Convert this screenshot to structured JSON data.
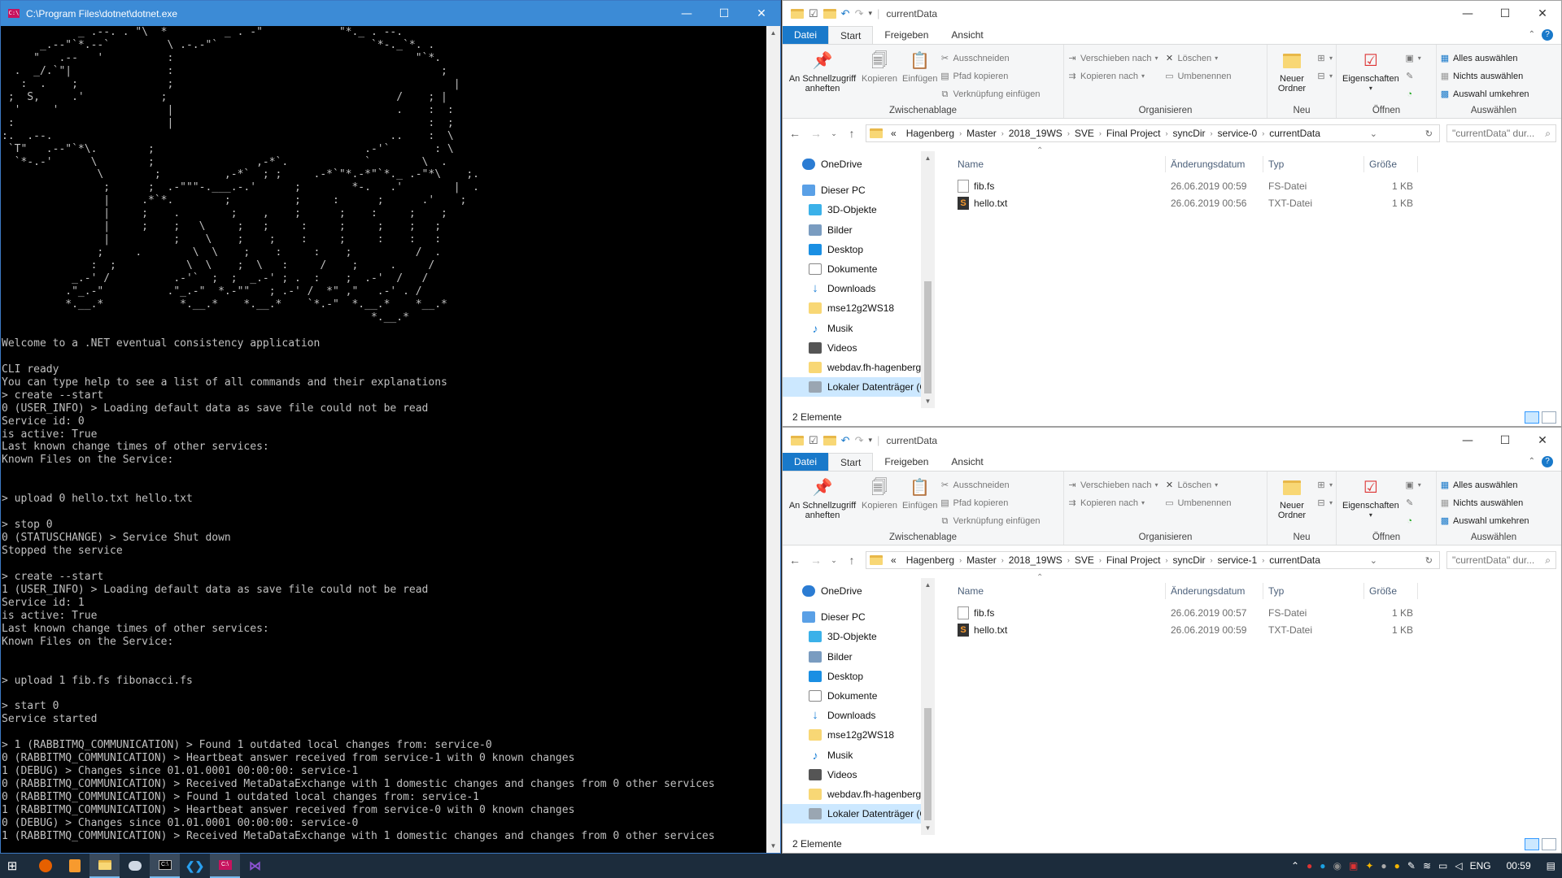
{
  "console": {
    "title": "C:\\Program Files\\dotnet\\dotnet.exe",
    "icon_label": "C:\\",
    "controls": {
      "minimize": "—",
      "maximize": "☐",
      "close": "✕"
    },
    "ascii_art": "            _ .--. . \"\\  *         _ . -\"            \"*._ . --.\n      _.--\"`*.--`         \\ .-.-\"`                        `*-._`*. .\n     \"   .--   '          :                                      \"`*.\n  .  _/.`\"|               :                                          ;\n   :  .    ;              ;                                            |\n ;  S,     .'            ;                                    /    ; |\n  '     '                 |                                   .    :  :\n :                        |                                        :  ;\n:.  .--.                                                     ..    :  \\\n `T\"   .--\"`*\\.        ;                                 .-'`       : \\\n  `*-.-'      \\        ;                ,-*`.            `        \\  .\n               \\        ;          ,-*`  ; ;     .-*`\"*.-*\"`*._ .-\"*\\    ;.\n                ;      ;  .-\"\"\"-.___.-.'      ;        *-.   .'        |  .\n                |     .*`*.        ;          ;     :      ;      .'    ;\n                |     ;    .        ;    ,    ;      ;    :     ;    ;\n                |     ;    ;   \\     ;   ;     :     ;     ;    ;   ;\n                |          ;    \\    ;    ;    :     ;     :    :   :\n               ;     .        \\  \\    ;    :     :    ;          /  .\n              :  ;           \\  \\    ;  \\   :     /    ;     .     /\n           _.-' /          .-'`  ;  ;  _.-' ; .  :    ;  .-'  /   /\n          .\"_.-\"          .\"_.-\"  *.-\"\"   ; .-' /  *\" ,\"   .-' . /\n          *.__.*            *.__.*    *.__.*    `*.-\"  *.__.*    *__.*\n                                                          *.__.*",
    "log_lines": [
      "",
      "Welcome to a .NET eventual consistency application",
      "",
      "CLI ready",
      "You can type help to see a list of all commands and their explanations",
      "> create --start",
      "0 (USER_INFO) > Loading default data as save file could not be read",
      "Service id: 0",
      "is active: True",
      "Last known change times of other services:",
      "Known Files on the Service:",
      "",
      "",
      "> upload 0 hello.txt hello.txt",
      "",
      "> stop 0",
      "0 (STATUSCHANGE) > Service Shut down",
      "Stopped the service",
      "",
      "> create --start",
      "1 (USER_INFO) > Loading default data as save file could not be read",
      "Service id: 1",
      "is active: True",
      "Last known change times of other services:",
      "Known Files on the Service:",
      "",
      "",
      "> upload 1 fib.fs fibonacci.fs",
      "",
      "> start 0",
      "Service started",
      "",
      "> 1 (RABBITMQ_COMMUNICATION) > Found 1 outdated local changes from: service-0",
      "0 (RABBITMQ_COMMUNICATION) > Heartbeat answer received from service-1 with 0 known changes",
      "1 (DEBUG) > Changes since 01.01.0001 00:00:00: service-1",
      "0 (RABBITMQ_COMMUNICATION) > Received MetaDataExchange with 1 domestic changes and changes from 0 other services",
      "0 (RABBITMQ_COMMUNICATION) > Found 1 outdated local changes from: service-1",
      "1 (RABBITMQ_COMMUNICATION) > Heartbeat answer received from service-0 with 0 known changes",
      "0 (DEBUG) > Changes since 01.01.0001 00:00:00: service-0",
      "1 (RABBITMQ_COMMUNICATION) > Received MetaDataExchange with 1 domestic changes and changes from 0 other services"
    ]
  },
  "explorer_common": {
    "window_title": "currentData",
    "tabs": {
      "file": "Datei",
      "start": "Start",
      "share": "Freigeben",
      "view": "Ansicht"
    },
    "help": "?",
    "ribbon": {
      "pin_quick": "An Schnellzugriff anheften",
      "copy": "Kopieren",
      "paste": "Einfügen",
      "cut": "Ausschneiden",
      "copy_path": "Pfad kopieren",
      "paste_shortcut": "Verknüpfung einfügen",
      "group_clipboard": "Zwischenablage",
      "move_to": "Verschieben nach",
      "copy_to": "Kopieren nach",
      "delete": "Löschen",
      "rename": "Umbenennen",
      "group_organize": "Organisieren",
      "new_folder": "Neuer Ordner",
      "group_new": "Neu",
      "properties": "Eigenschaften",
      "group_open": "Öffnen",
      "select_all": "Alles auswählen",
      "select_none": "Nichts auswählen",
      "invert_selection": "Auswahl umkehren",
      "group_select": "Auswählen"
    },
    "columns": {
      "name": "Name",
      "date": "Änderungsdatum",
      "type": "Typ",
      "size": "Größe"
    },
    "search_placeholder": "\"currentData\" dur...",
    "nav": {
      "onedrive": "OneDrive",
      "this_pc": "Dieser PC",
      "objects3d": "3D-Objekte",
      "pictures": "Bilder",
      "desktop": "Desktop",
      "documents": "Dokumente",
      "downloads": "Downloads",
      "folder_mse": "mse12g2WS18",
      "music": "Musik",
      "videos": "Videos",
      "webdav": "webdav.fh-hagenberg.at",
      "local_disk": "Lokaler Datenträger (C:)"
    },
    "status": "2 Elemente"
  },
  "explorer_top": {
    "breadcrumbs": [
      "«",
      "Hagenberg",
      "Master",
      "2018_19WS",
      "SVE",
      "Final Project",
      "syncDir",
      "service-0",
      "currentData"
    ],
    "files": [
      {
        "name": "fib.fs",
        "date": "26.06.2019 00:59",
        "type": "FS-Datei",
        "size": "1 KB",
        "icon": "file-icon"
      },
      {
        "name": "hello.txt",
        "date": "26.06.2019 00:56",
        "type": "TXT-Datei",
        "size": "1 KB",
        "icon": "sublime-file-icon"
      }
    ]
  },
  "explorer_bottom": {
    "breadcrumbs": [
      "«",
      "Hagenberg",
      "Master",
      "2018_19WS",
      "SVE",
      "Final Project",
      "syncDir",
      "service-1",
      "currentData"
    ],
    "files": [
      {
        "name": "fib.fs",
        "date": "26.06.2019 00:57",
        "type": "FS-Datei",
        "size": "1 KB",
        "icon": "file-icon"
      },
      {
        "name": "hello.txt",
        "date": "26.06.2019 00:59",
        "type": "TXT-Datei",
        "size": "1 KB",
        "icon": "sublime-file-icon"
      }
    ]
  },
  "taskbar": {
    "apps": [
      "windows-start-icon",
      "firefox-icon",
      "sublime-icon",
      "file-explorer-icon",
      "app-icon",
      "console-icon",
      "vscode-icon",
      "dotnet-console-icon",
      "visual-studio-icon"
    ],
    "language": "ENG",
    "clock": "00:59"
  }
}
